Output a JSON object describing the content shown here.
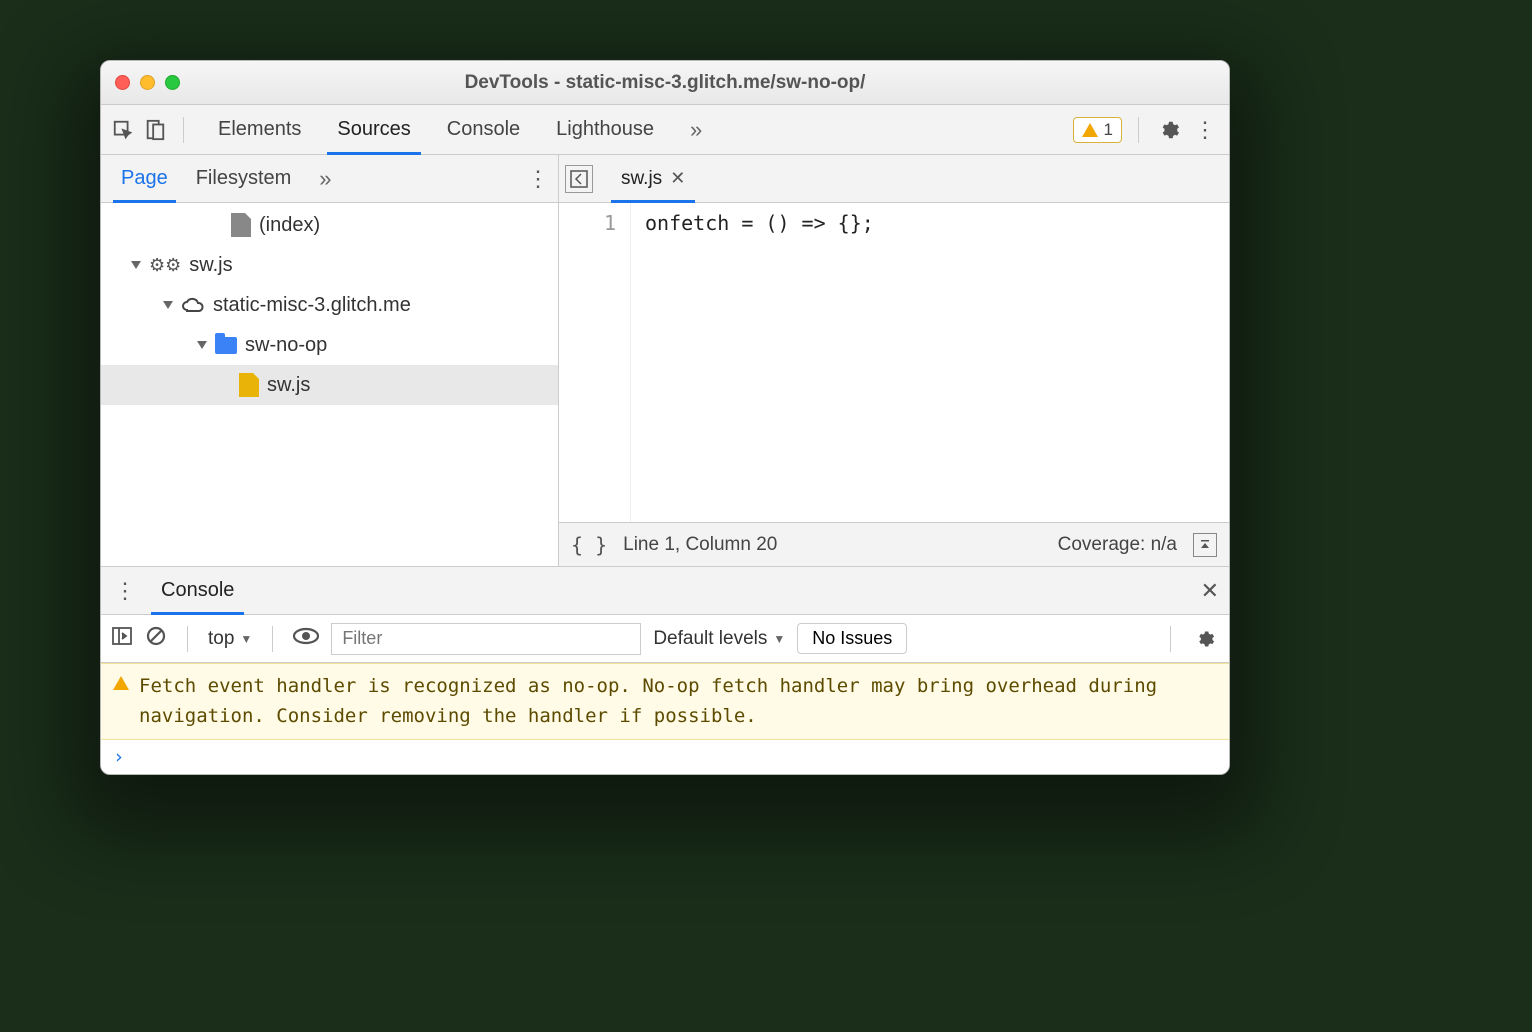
{
  "window": {
    "title": "DevTools - static-misc-3.glitch.me/sw-no-op/"
  },
  "toolbar": {
    "tabs": [
      "Elements",
      "Sources",
      "Console",
      "Lighthouse"
    ],
    "active_tab": "Sources",
    "overflow_glyph": "»",
    "warning_count": "1"
  },
  "sources": {
    "panel_tabs": [
      "Page",
      "Filesystem"
    ],
    "panel_active": "Page",
    "overflow_glyph": "»",
    "tree": {
      "index_label": "(index)",
      "worker_label": "sw.js",
      "domain_label": "static-misc-3.glitch.me",
      "folder_label": "sw-no-op",
      "file_label": "sw.js"
    },
    "editor": {
      "tab_label": "sw.js",
      "line_number": "1",
      "code": "onfetch = () => {};",
      "status_position": "Line 1, Column 20",
      "coverage_label": "Coverage: n/a"
    }
  },
  "drawer": {
    "tab_label": "Console",
    "context_label": "top",
    "filter_placeholder": "Filter",
    "levels_label": "Default levels",
    "issues_label": "No Issues",
    "warning_message": "Fetch event handler is recognized as no-op. No-op fetch handler may bring overhead during navigation. Consider removing the handler if possible.",
    "prompt_glyph": "›"
  }
}
